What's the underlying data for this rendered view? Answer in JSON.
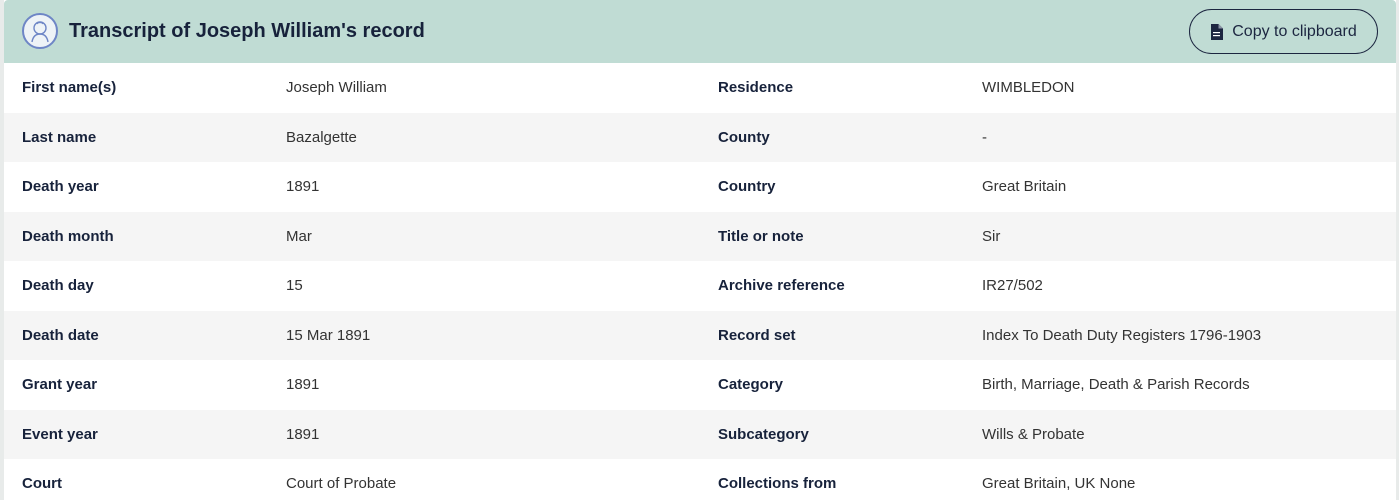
{
  "header": {
    "title": "Transcript of Joseph William's record",
    "avatar_icon": "person-portrait-icon",
    "copy_label": "Copy to clipboard",
    "copy_icon": "document-icon",
    "background": "#c0dcd4"
  },
  "rows": [
    {
      "label_left": "First name(s)",
      "value_left": "Joseph William",
      "label_right": "Residence",
      "value_right": "WIMBLEDON"
    },
    {
      "label_left": "Last name",
      "value_left": "Bazalgette",
      "label_right": "County",
      "value_right": "-"
    },
    {
      "label_left": "Death year",
      "value_left": "1891",
      "label_right": "Country",
      "value_right": "Great Britain"
    },
    {
      "label_left": "Death month",
      "value_left": "Mar",
      "label_right": "Title or note",
      "value_right": "Sir"
    },
    {
      "label_left": "Death day",
      "value_left": "15",
      "label_right": "Archive reference",
      "value_right": "IR27/502"
    },
    {
      "label_left": "Death date",
      "value_left": "15 Mar 1891",
      "label_right": "Record set",
      "value_right": "Index To Death Duty Registers 1796-1903"
    },
    {
      "label_left": "Grant year",
      "value_left": "1891",
      "label_right": "Category",
      "value_right": "Birth, Marriage, Death & Parish Records"
    },
    {
      "label_left": "Event year",
      "value_left": "1891",
      "label_right": "Subcategory",
      "value_right": "Wills & Probate"
    },
    {
      "label_left": "Court",
      "value_left": "Court of Probate",
      "label_right": "Collections from",
      "value_right": "Great Britain, UK None"
    }
  ]
}
